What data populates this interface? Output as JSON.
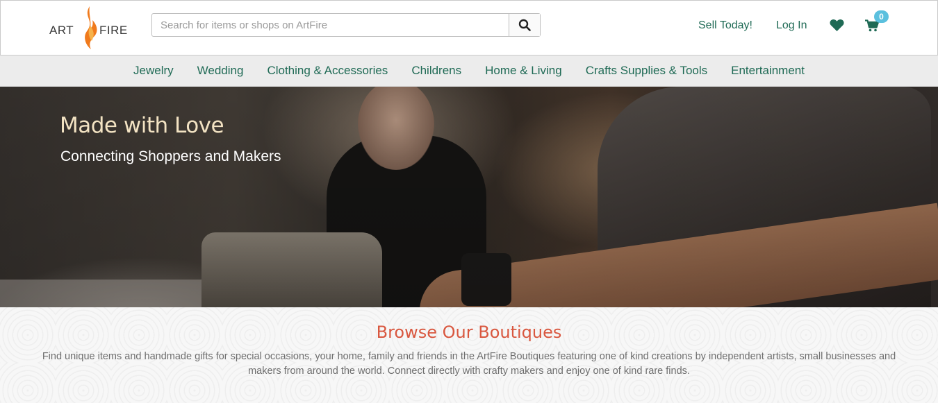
{
  "header": {
    "logo": {
      "text_left": "ART",
      "text_right": "FIRE",
      "icon": "flame-icon"
    },
    "search": {
      "placeholder": "Search for items or shops on ArtFire",
      "value": "",
      "button_icon": "search-icon"
    },
    "links": {
      "sell": "Sell Today!",
      "login": "Log In"
    },
    "wishlist_icon": "heart-icon",
    "cart": {
      "icon": "cart-icon",
      "count": "0"
    }
  },
  "nav": {
    "items": [
      {
        "label": "Jewelry"
      },
      {
        "label": "Wedding"
      },
      {
        "label": "Clothing & Accessories"
      },
      {
        "label": "Childrens"
      },
      {
        "label": "Home & Living"
      },
      {
        "label": "Crafts Supplies & Tools"
      },
      {
        "label": "Entertainment"
      }
    ]
  },
  "hero": {
    "title": "Made with Love",
    "subtitle": "Connecting Shoppers and Makers"
  },
  "browse": {
    "title": "Browse Our Boutiques",
    "description": "Find unique items and handmade gifts for special occasions, your home, family and friends in the ArtFire Boutiques featuring one of kind creations by independent artists, small businesses and makers from around the world. Connect directly with crafty makers and enjoy one of kind rare finds."
  },
  "colors": {
    "brand_green": "#1f6a55",
    "accent_red": "#d9573f",
    "badge_blue": "#5bc0de",
    "hero_title": "#f3e3c3"
  }
}
